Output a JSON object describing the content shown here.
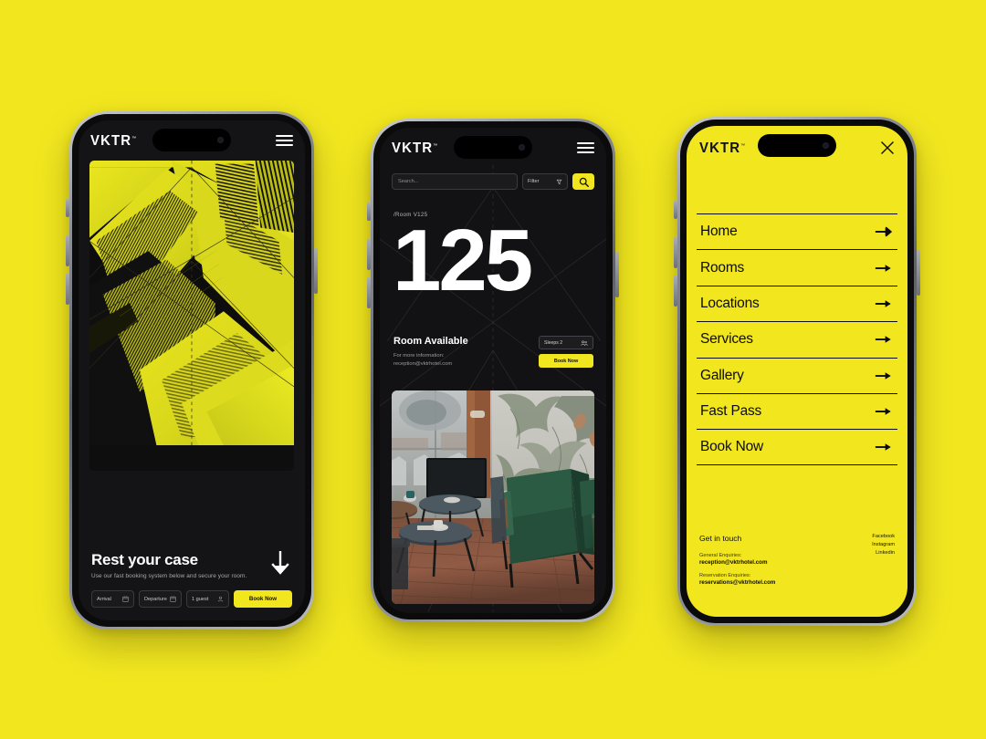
{
  "page": {
    "background_color": "#F2E71F",
    "brand": "VKTR",
    "trademark": "™"
  },
  "phone1": {
    "logo": "VKTR",
    "menu_icon": "hamburger-icon",
    "hero_alt": "duotone-architecture-photo",
    "title": "Rest your case",
    "subtitle": "Use our fast booking system below and secure your room.",
    "scroll_icon": "arrow-down-icon",
    "booking": {
      "arrival_label": "Arrival",
      "arrival_icon": "calendar-icon",
      "departure_label": "Departure",
      "departure_icon": "calendar-icon",
      "guests_label": "1 guest",
      "guests_icon": "person-icon",
      "book_label": "Book Now"
    }
  },
  "phone2": {
    "logo": "VKTR",
    "menu_icon": "hamburger-icon",
    "search": {
      "placeholder": "Search...",
      "filter_label": "Filter",
      "filter_icon": "filter-icon",
      "submit_icon": "search-icon"
    },
    "breadcrumb": "/Room V125",
    "room_number": "125",
    "status_title": "Room Available",
    "contact_line1": "For more information:",
    "contact_line2": "reception@vktrhotel.com",
    "sleeps_label": "Sleeps 2",
    "sleeps_icon": "people-icon",
    "book_label": "Book Now",
    "photo_alt": "hotel-lounge-interior-photo"
  },
  "phone3": {
    "logo": "VKTR",
    "close_icon": "close-icon",
    "menu_items": [
      {
        "label": "Home",
        "icon": "arrow-right-icon"
      },
      {
        "label": "Rooms",
        "icon": "arrow-right-icon"
      },
      {
        "label": "Locations",
        "icon": "arrow-right-icon"
      },
      {
        "label": "Services",
        "icon": "arrow-right-icon"
      },
      {
        "label": "Gallery",
        "icon": "arrow-right-icon"
      },
      {
        "label": "Fast Pass",
        "icon": "arrow-right-icon"
      },
      {
        "label": "Book Now",
        "icon": "arrow-right-icon"
      }
    ],
    "footer": {
      "heading": "Get in touch",
      "general_key": "General Enquiries:",
      "general_value": "reception@vktrhotel.com",
      "reservation_key": "Reservation Enquiries:",
      "reservation_value": "reservations@vktrhotel.com",
      "social": [
        "Facebook",
        "Instagram",
        "Linkedin"
      ]
    }
  }
}
